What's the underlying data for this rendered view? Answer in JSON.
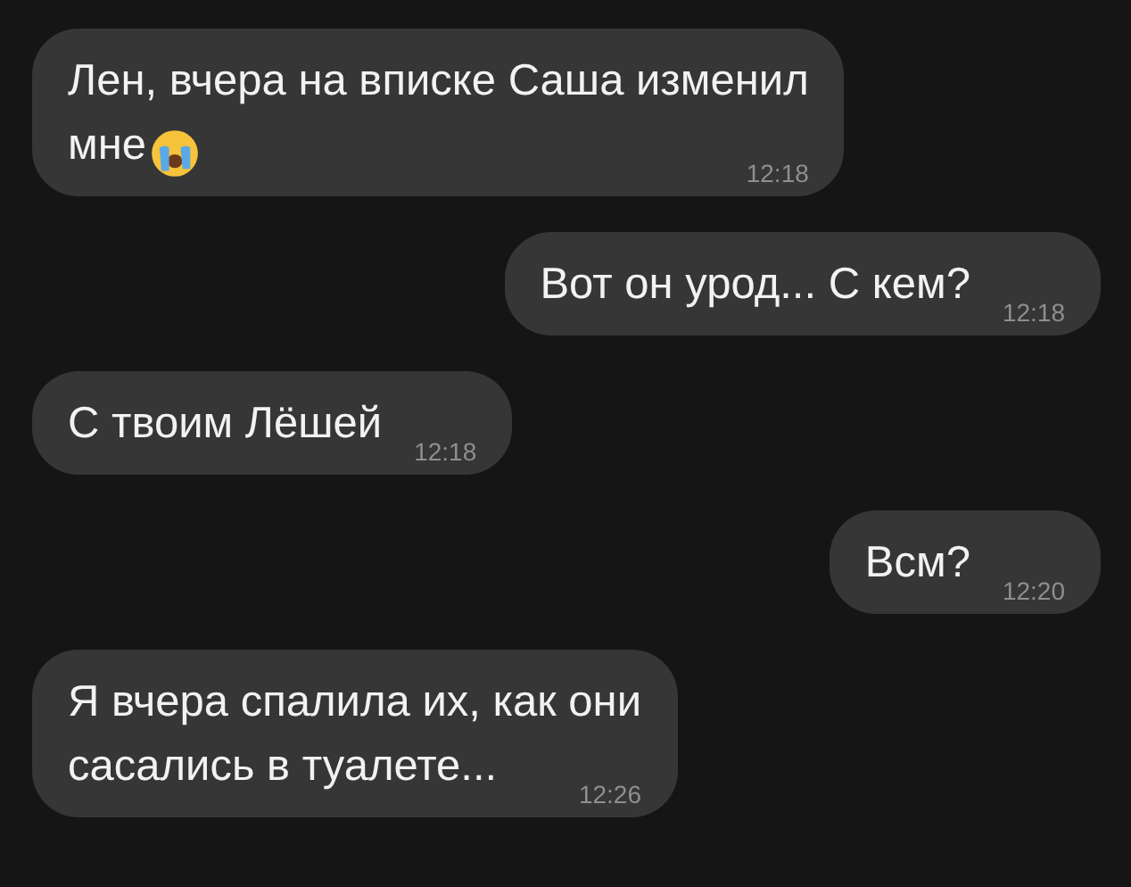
{
  "messages": [
    {
      "outgoing": false,
      "lines": [
        "Лен, вчера на вписке Саша изменил",
        "мне"
      ],
      "trailing_emoji": true,
      "time": "12:18"
    },
    {
      "outgoing": true,
      "lines": [
        "Вот он урод... С кем?"
      ],
      "trailing_emoji": false,
      "time": "12:18"
    },
    {
      "outgoing": false,
      "lines": [
        "С твоим Лёшей"
      ],
      "trailing_emoji": false,
      "time": "12:18"
    },
    {
      "outgoing": true,
      "lines": [
        "Всм?"
      ],
      "trailing_emoji": false,
      "time": "12:20"
    },
    {
      "outgoing": false,
      "lines": [
        "Я вчера спалила их, как они",
        "сасались в туалете..."
      ],
      "trailing_emoji": false,
      "time": "12:26"
    }
  ]
}
